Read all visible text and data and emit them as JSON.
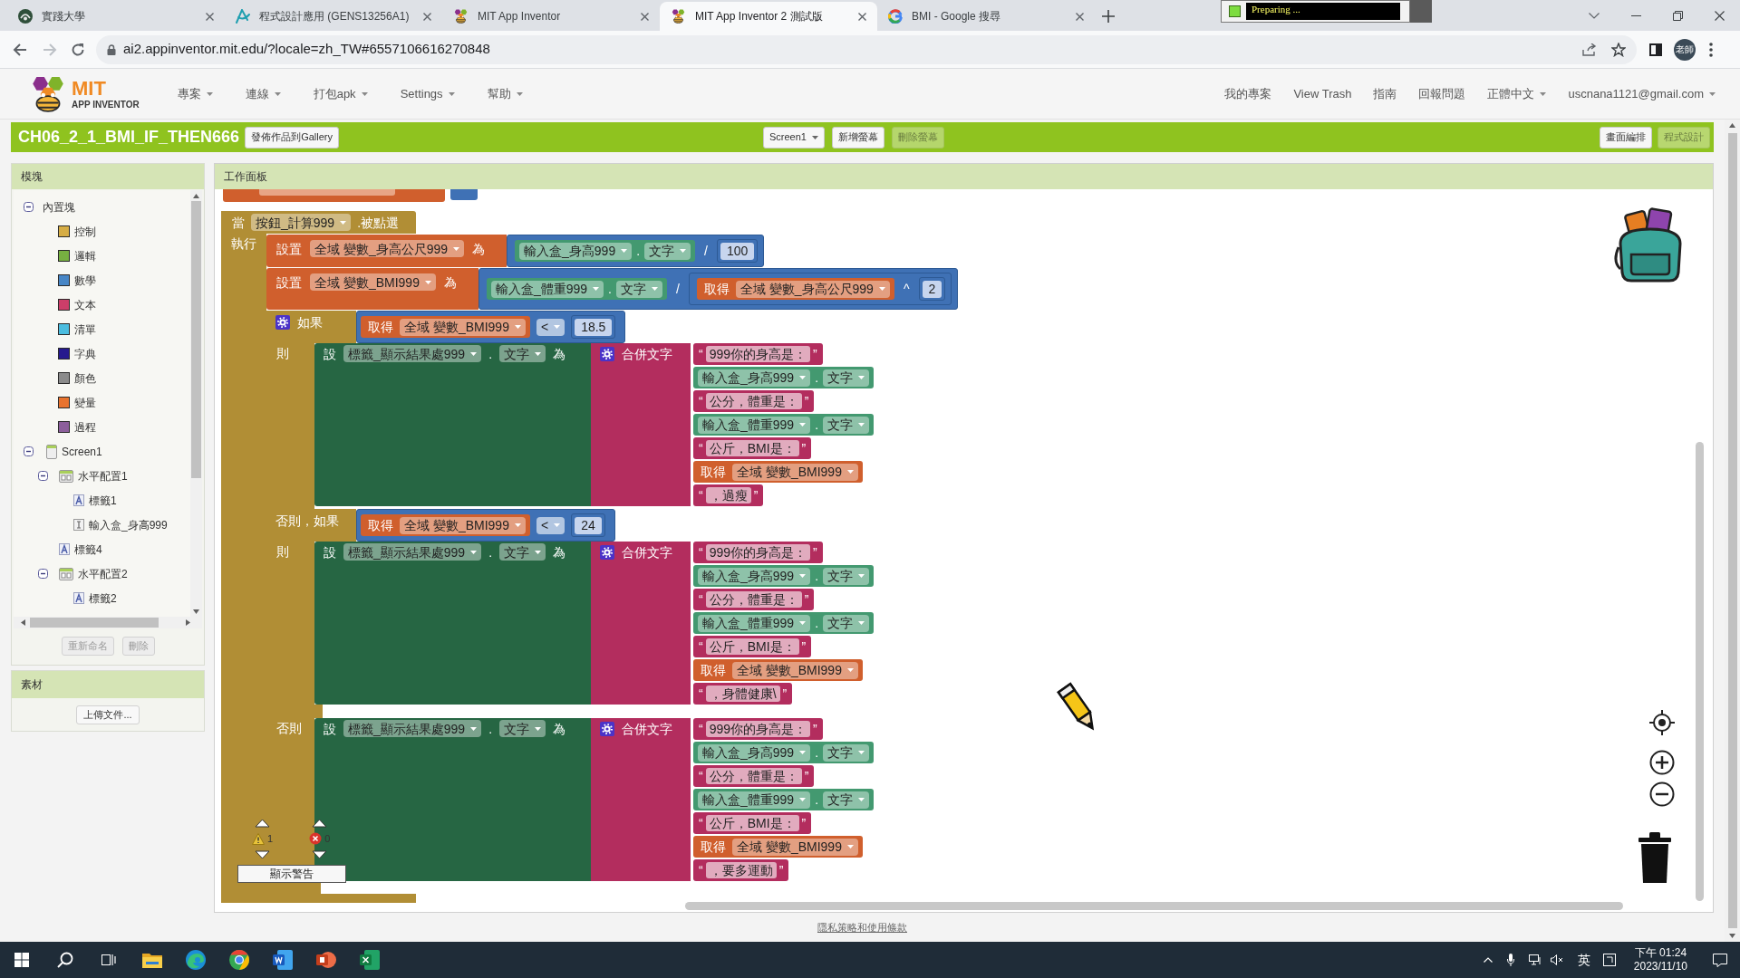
{
  "browser": {
    "tabs": [
      {
        "kind": "school",
        "title": "實踐大學",
        "selected": false
      },
      {
        "kind": "course",
        "title": "程式設計應用 (GENS13256A1)",
        "selected": false
      },
      {
        "kind": "appinventor",
        "title": "MIT App Inventor",
        "selected": false
      },
      {
        "kind": "appinventor",
        "title": "MIT App Inventor 2 測試版",
        "selected": true
      },
      {
        "kind": "google",
        "title": "BMI - Google 搜尋",
        "selected": false
      }
    ],
    "status_popup": "Preparing ...",
    "url": "ai2.appinventor.mit.edu/?locale=zh_TW#6557106616270848",
    "profile": "老師"
  },
  "app": {
    "logo": {
      "title": "MIT",
      "subtitle": "APP INVENTOR"
    },
    "menus": [
      {
        "label": "專案",
        "dropdown": true
      },
      {
        "label": "連線",
        "dropdown": true
      },
      {
        "label": "打包apk",
        "dropdown": true
      },
      {
        "label": "Settings",
        "dropdown": true
      },
      {
        "label": "幫助",
        "dropdown": true
      }
    ],
    "links": [
      {
        "label": "我的專案",
        "dropdown": false
      },
      {
        "label": "View Trash",
        "dropdown": false
      },
      {
        "label": "指南",
        "dropdown": false
      },
      {
        "label": "回報問題",
        "dropdown": false
      },
      {
        "label": "正體中文",
        "dropdown": true
      },
      {
        "label": "uscnana1121@gmail.com",
        "dropdown": true
      }
    ]
  },
  "project_bar": {
    "title": "CH06_2_1_BMI_IF_THEN666",
    "gallery_button": "發佈作品到Gallery",
    "screen_select": "Screen1",
    "screen_buttons": [
      {
        "label": "新增螢幕",
        "disabled": false
      },
      {
        "label": "刪除螢幕",
        "disabled": true
      }
    ],
    "editors": [
      {
        "label": "畫面編排",
        "selected": false
      },
      {
        "label": "程式設計",
        "selected": true
      }
    ]
  },
  "blocks_panel": {
    "title": "模塊",
    "tree": [
      {
        "kind": "group",
        "label": "內置塊",
        "expanded": true,
        "children": [
          {
            "kind": "category",
            "label": "控制",
            "color": "#d6ad45"
          },
          {
            "kind": "category",
            "label": "邏輯",
            "color": "#77b041"
          },
          {
            "kind": "category",
            "label": "數學",
            "color": "#4786c6"
          },
          {
            "kind": "category",
            "label": "文本",
            "color": "#cc3e69"
          },
          {
            "kind": "category",
            "label": "清單",
            "color": "#4bbde0"
          },
          {
            "kind": "category",
            "label": "字典",
            "color": "#261a8e"
          },
          {
            "kind": "category",
            "label": "顏色",
            "color": "#8b8b8b"
          },
          {
            "kind": "category",
            "label": "變量",
            "color": "#e8732e"
          },
          {
            "kind": "category",
            "label": "過程",
            "color": "#8c5f9b"
          }
        ]
      },
      {
        "kind": "screen",
        "label": "Screen1",
        "expanded": true,
        "children": [
          {
            "kind": "arrangement",
            "label": "水平配置1",
            "expanded": true,
            "children": [
              {
                "kind": "label",
                "label": "標籤1"
              },
              {
                "kind": "textbox",
                "label": "輸入盒_身高999"
              }
            ]
          },
          {
            "kind": "label",
            "label": "標籤4"
          },
          {
            "kind": "arrangement",
            "label": "水平配置2",
            "expanded": true,
            "children": [
              {
                "kind": "label",
                "label": "標籤2"
              }
            ]
          }
        ]
      }
    ],
    "buttons": [
      {
        "label": "重新命名",
        "disabled": true
      },
      {
        "label": "刪除",
        "disabled": true
      }
    ]
  },
  "media_panel": {
    "title": "素材",
    "button": "上傳文件..."
  },
  "workspace": {
    "title": "工作面板",
    "program": {
      "when": "當",
      "component": "按鈕_計算999",
      "event": ".被點選",
      "do": "執行",
      "body": [
        {
          "kind": "set_var",
          "label": "設置",
          "var": "全域 變數_身高公尺999",
          "to": "為",
          "value": {
            "kind": "math_op",
            "op": "/",
            "left": {
              "kind": "getter",
              "component": "輸入盒_身高999",
              "dot": ".",
              "prop": "文字"
            },
            "right": {
              "kind": "number",
              "value": "100"
            }
          }
        },
        {
          "kind": "set_var",
          "label": "設置",
          "var": "全域 變數_BMI999",
          "to": "為",
          "value": {
            "kind": "math_op",
            "op": "/",
            "left": {
              "kind": "getter",
              "component": "輸入盒_體重999",
              "dot": ".",
              "prop": "文字"
            },
            "right": {
              "kind": "math_op",
              "op": "^",
              "left": {
                "kind": "get_var",
                "label": "取得",
                "var": "全域 變數_身高公尺999"
              },
              "right": {
                "kind": "number",
                "value": "2"
              }
            }
          }
        },
        {
          "kind": "if",
          "branches": [
            {
              "label": "如果",
              "cond": {
                "kind": "compare",
                "op": "<",
                "left": {
                  "kind": "get_var",
                  "label": "取得",
                  "var": "全域 變數_BMI999"
                },
                "right": {
                  "kind": "number",
                  "value": "18.5"
                }
              },
              "then": "則",
              "body": [
                {
                  "kind": "set_prop",
                  "label": "設",
                  "component": "標籤_顯示結果處999",
                  "dot": ".",
                  "prop": "文字",
                  "to": "為",
                  "value": {
                    "kind": "join",
                    "label": "合併文字",
                    "items": [
                      {
                        "kind": "text",
                        "open": "“",
                        "value": "999你的身高是：",
                        "close": "”"
                      },
                      {
                        "kind": "getter",
                        "component": "輸入盒_身高999",
                        "dot": ".",
                        "prop": "文字"
                      },
                      {
                        "kind": "text",
                        "open": "“",
                        "value": "公分，體重是：",
                        "close": "”"
                      },
                      {
                        "kind": "getter",
                        "component": "輸入盒_體重999",
                        "dot": ".",
                        "prop": "文字"
                      },
                      {
                        "kind": "text",
                        "open": "“",
                        "value": "公斤，BMI是：",
                        "close": "”"
                      },
                      {
                        "kind": "get_var",
                        "label": "取得",
                        "var": "全域 變數_BMI999"
                      },
                      {
                        "kind": "text",
                        "open": "“",
                        "value": "，過瘦",
                        "close": "”"
                      }
                    ]
                  }
                }
              ]
            },
            {
              "label": "否則，如果",
              "cond": {
                "kind": "compare",
                "op": "<",
                "left": {
                  "kind": "get_var",
                  "label": "取得",
                  "var": "全域 變數_BMI999"
                },
                "right": {
                  "kind": "number",
                  "value": "24"
                }
              },
              "then": "則",
              "body": [
                {
                  "kind": "set_prop",
                  "label": "設",
                  "component": "標籤_顯示結果處999",
                  "dot": ".",
                  "prop": "文字",
                  "to": "為",
                  "value": {
                    "kind": "join",
                    "label": "合併文字",
                    "items": [
                      {
                        "kind": "text",
                        "open": "“",
                        "value": "999你的身高是：",
                        "close": "”"
                      },
                      {
                        "kind": "getter",
                        "component": "輸入盒_身高999",
                        "dot": ".",
                        "prop": "文字"
                      },
                      {
                        "kind": "text",
                        "open": "“",
                        "value": "公分，體重是：",
                        "close": "”"
                      },
                      {
                        "kind": "getter",
                        "component": "輸入盒_體重999",
                        "dot": ".",
                        "prop": "文字"
                      },
                      {
                        "kind": "text",
                        "open": "“",
                        "value": "公斤，BMI是：",
                        "close": "”"
                      },
                      {
                        "kind": "get_var",
                        "label": "取得",
                        "var": "全域 變數_BMI999"
                      },
                      {
                        "kind": "text",
                        "open": "“",
                        "value": "，身體健康\\",
                        "close": "”"
                      }
                    ]
                  }
                }
              ]
            },
            {
              "label": "否則",
              "body": [
                {
                  "kind": "set_prop",
                  "label": "設",
                  "component": "標籤_顯示結果處999",
                  "dot": ".",
                  "prop": "文字",
                  "to": "為",
                  "value": {
                    "kind": "join",
                    "label": "合併文字",
                    "items": [
                      {
                        "kind": "text",
                        "open": "“",
                        "value": "999你的身高是：",
                        "close": "”"
                      },
                      {
                        "kind": "getter",
                        "component": "輸入盒_身高999",
                        "dot": ".",
                        "prop": "文字"
                      },
                      {
                        "kind": "text",
                        "open": "“",
                        "value": "公分，體重是：",
                        "close": "”"
                      },
                      {
                        "kind": "getter",
                        "component": "輸入盒_體重999",
                        "dot": ".",
                        "prop": "文字"
                      },
                      {
                        "kind": "text",
                        "open": "“",
                        "value": "公斤，BMI是：",
                        "close": "”"
                      },
                      {
                        "kind": "get_var",
                        "label": "取得",
                        "var": "全域 變數_BMI999"
                      },
                      {
                        "kind": "text",
                        "open": "“",
                        "value": "，要多運動",
                        "close": "”"
                      }
                    ]
                  }
                }
              ]
            }
          ]
        }
      ]
    },
    "warnings": {
      "warning_count": "1",
      "error_count": "0",
      "button": "顯示警告"
    }
  },
  "footer": {
    "link": "隱私策略和使用條款"
  },
  "taskbar": {
    "input_language": "英",
    "time": "下午 01:24",
    "date": "2023/11/10"
  }
}
